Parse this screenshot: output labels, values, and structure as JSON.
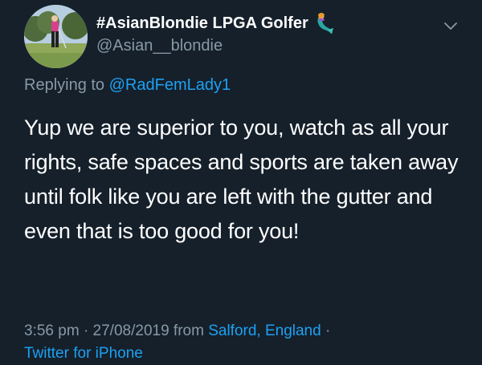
{
  "tweet": {
    "display_name": "#AsianBlondie LPGA Golfer",
    "handle": "@Asian__blondie",
    "name_emoji": "mermaid-icon",
    "replying_prefix": "Replying to",
    "replying_to": "@RadFemLady1",
    "text": "Yup we are superior to you, watch as all your rights, safe spaces and sports are taken away until folk like you are left with the gutter and even that is too good for you!",
    "time": "3:56 pm",
    "separator": "·",
    "date": "27/08/2019",
    "from_label": "from",
    "location": "Salford, England",
    "source": "Twitter for iPhone",
    "menu_icon": "chevron-down-icon"
  },
  "colors": {
    "background": "#15202b",
    "primary_text": "#ffffff",
    "secondary_text": "#8899a6",
    "link": "#1da1f2"
  }
}
